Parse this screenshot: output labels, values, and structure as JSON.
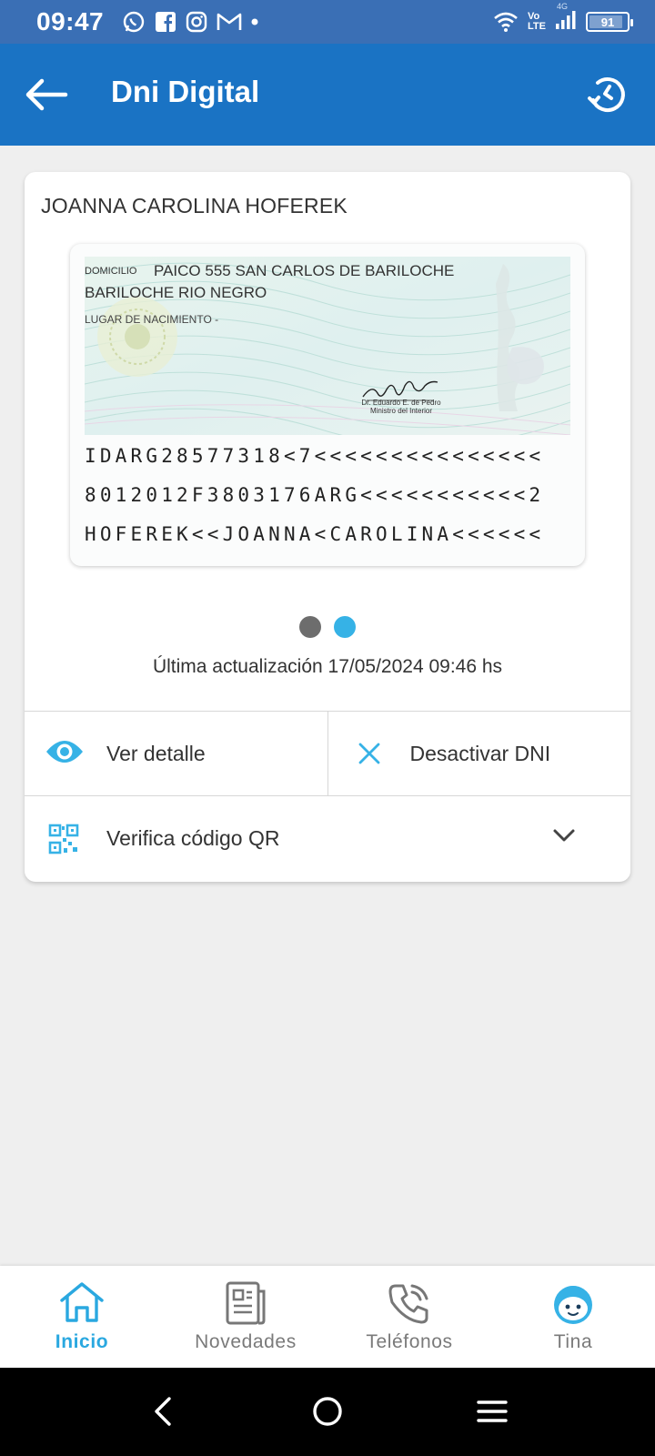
{
  "status_bar": {
    "time": "09:47",
    "network_top": "Vo",
    "network_bottom": "LTE",
    "signal_tag": "4G",
    "battery": "91",
    "battery_level": 0.91,
    "notification_icons": [
      "whatsapp-icon",
      "facebook-icon",
      "instagram-icon",
      "gmail-icon"
    ]
  },
  "app_bar": {
    "title": "Dni Digital",
    "back_icon": "arrow-left-icon",
    "refresh_icon": "refresh-icon"
  },
  "card": {
    "holder_name": "JOANNA CAROLINA HOFEREK",
    "dni_back": {
      "domicilio_label": "DOMICILIO",
      "address_line1": "PAICO 555 SAN CARLOS DE BARILOCHE",
      "address_line2": "BARILOCHE RIO NEGRO",
      "birthplace_label": "LUGAR DE NACIMIENTO -",
      "signer_name": "Dr. Eduardo E. de Pedro",
      "signer_title": "Ministro del Interior",
      "mrz": [
        "IDARG28577318<7<<<<<<<<<<<<<<<",
        "8012012F3803176ARG<<<<<<<<<<<2",
        "HOFEREK<<JOANNA<CAROLINA<<<<<<"
      ]
    },
    "carousel": {
      "pages": 2,
      "active_page": 2
    },
    "last_update": "Última actualización 17/05/2024 09:46 hs",
    "actions": {
      "detail_label": "Ver detalle",
      "deactivate_label": "Desactivar DNI"
    },
    "qr": {
      "label": "Verifica código QR"
    }
  },
  "bottom_nav": {
    "items": [
      {
        "label": "Inicio",
        "icon": "home-icon",
        "active": true
      },
      {
        "label": "Novedades",
        "icon": "news-icon",
        "active": false
      },
      {
        "label": "Teléfonos",
        "icon": "phone-icon",
        "active": false
      },
      {
        "label": "Tina",
        "icon": "tina-face-icon",
        "active": false
      }
    ]
  },
  "colors": {
    "status_bar": "#3a6fb5",
    "app_bar": "#1a73c4",
    "accent": "#36b2e6",
    "background": "#efefef"
  }
}
